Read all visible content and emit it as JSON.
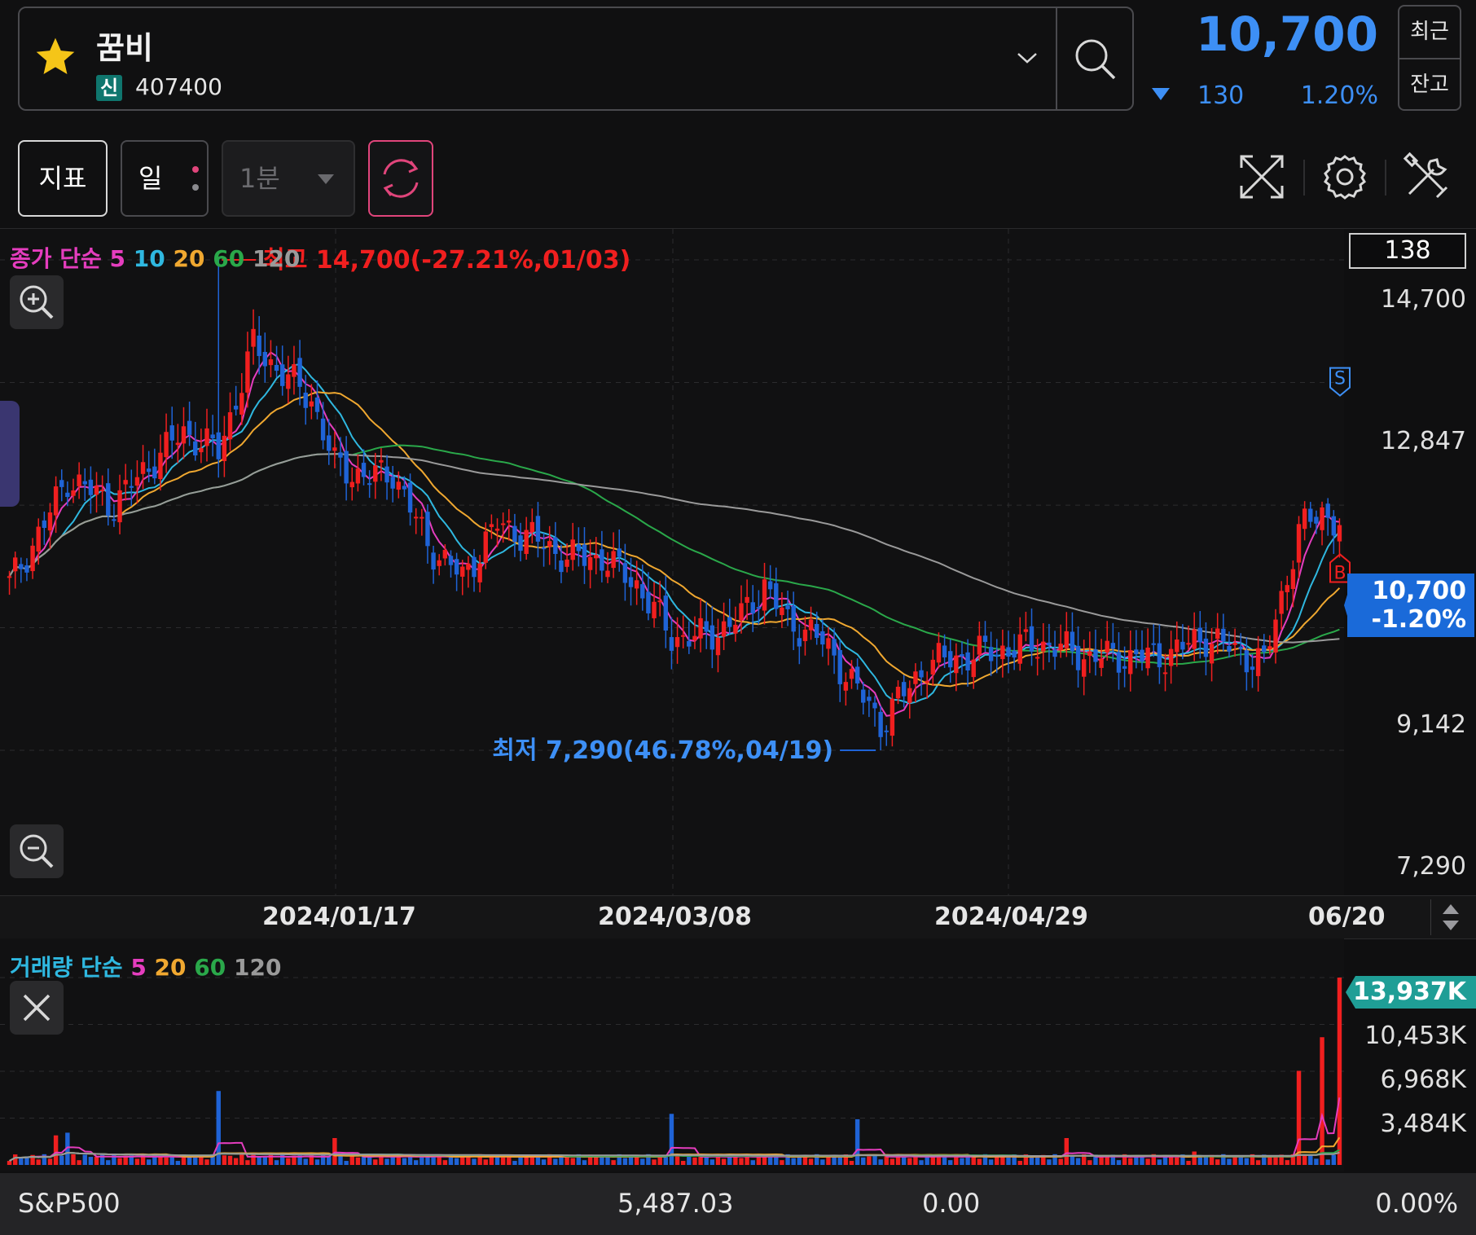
{
  "header": {
    "stock_name": "꿈비",
    "badge": "신",
    "stock_code": "407400",
    "price": "10,700",
    "change": "130",
    "change_pct": "1.20%",
    "btn_recent": "최근",
    "btn_balance": "잔고"
  },
  "toolbar": {
    "indicator_label": "지표",
    "period_label": "일",
    "interval_label": "1분"
  },
  "price_chart": {
    "legend": {
      "title": "종가 단순",
      "ma5": "5",
      "ma10": "10",
      "ma20": "20",
      "ma60": "60",
      "ma120": "120"
    },
    "count": "138",
    "y_labels": [
      "14,700",
      "12,847",
      "10,700",
      "9,142",
      "7,290"
    ],
    "current_tag_price": "10,700",
    "current_tag_pct": "-1.20%",
    "high_annotation": "최고 14,700(-27.21%,01/03)",
    "low_annotation": "최저 7,290(46.78%,04/19)",
    "signal_s": "S",
    "signal_b": "B"
  },
  "x_labels": [
    "2024/01/17",
    "2024/03/08",
    "2024/04/29",
    "06/20"
  ],
  "volume_chart": {
    "legend": {
      "title": "거래량 단순",
      "ma5": "5",
      "ma20": "20",
      "ma60": "60",
      "ma120": "120"
    },
    "y_labels": [
      "13,937K",
      "10,453K",
      "6,968K",
      "3,484K"
    ]
  },
  "bottom_bar": {
    "index_name": "S&P500",
    "index_value": "5,487.03",
    "index_change": "0.00",
    "index_pct": "0.00%"
  },
  "colors": {
    "up": "#f01f1f",
    "down": "#1f63d6",
    "ma5": "#e53dbe",
    "ma10": "#2fb8e0",
    "ma20": "#f0a830",
    "ma60": "#2aa84a",
    "ma120": "#9a9a9a",
    "price_blue": "#3d8ff5"
  },
  "chart_data": {
    "type": "candlestick",
    "x_range": [
      "2023-12",
      "2024-06-20"
    ],
    "ylim": [
      7290,
      14700
    ],
    "high": {
      "value": 14700,
      "date": "01/03"
    },
    "low": {
      "value": 7290,
      "date": "04/19"
    },
    "last_close": 10700,
    "volume_ylim": [
      0,
      13937
    ]
  }
}
